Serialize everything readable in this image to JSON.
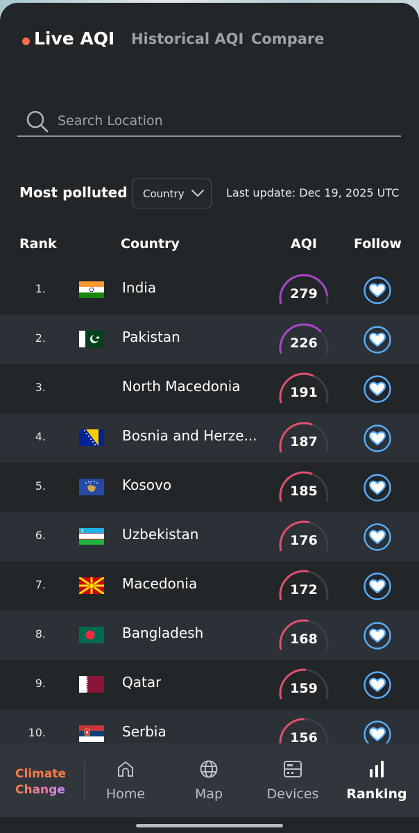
{
  "tabs": [
    {
      "label": "Live AQI",
      "active": true
    },
    {
      "label": "Historical AQI",
      "active": false
    },
    {
      "label": "Compare",
      "active": false
    }
  ],
  "search": {
    "placeholder": "Search Location",
    "value": ""
  },
  "filter": {
    "title": "Most polluted",
    "dropdown_selected": "Country",
    "last_update": "Last update: Dec 19, 2025 UTC"
  },
  "table": {
    "headers": {
      "rank": "Rank",
      "country": "Country",
      "aqi": "AQI",
      "follow": "Follow"
    },
    "rows": [
      {
        "rank": "1.",
        "country": "India",
        "aqi": 279,
        "flag": "india-flag",
        "gauge_color": "#a945c9",
        "gauge_fraction": 0.56
      },
      {
        "rank": "2.",
        "country": "Pakistan",
        "aqi": 226,
        "flag": "pakistan-flag",
        "gauge_color": "#a945c9",
        "gauge_fraction": 0.45
      },
      {
        "rank": "3.",
        "country": "North Macedonia",
        "aqi": 191,
        "flag": "none",
        "gauge_color": "#e0506c",
        "gauge_fraction": 0.38
      },
      {
        "rank": "4.",
        "country": "Bosnia and Herze...",
        "aqi": 187,
        "flag": "bosnia-flag",
        "gauge_color": "#e0506c",
        "gauge_fraction": 0.37
      },
      {
        "rank": "5.",
        "country": "Kosovo",
        "aqi": 185,
        "flag": "kosovo-flag",
        "gauge_color": "#e0506c",
        "gauge_fraction": 0.37
      },
      {
        "rank": "6.",
        "country": "Uzbekistan",
        "aqi": 176,
        "flag": "uzbekistan-flag",
        "gauge_color": "#e0506c",
        "gauge_fraction": 0.35
      },
      {
        "rank": "7.",
        "country": "Macedonia",
        "aqi": 172,
        "flag": "macedonia-flag",
        "gauge_color": "#e0506c",
        "gauge_fraction": 0.34
      },
      {
        "rank": "8.",
        "country": "Bangladesh",
        "aqi": 168,
        "flag": "bangladesh-flag",
        "gauge_color": "#e0506c",
        "gauge_fraction": 0.34
      },
      {
        "rank": "9.",
        "country": "Qatar",
        "aqi": 159,
        "flag": "qatar-flag",
        "gauge_color": "#e0506c",
        "gauge_fraction": 0.32
      },
      {
        "rank": "10.",
        "country": "Serbia",
        "aqi": 156,
        "flag": "serbia-flag",
        "gauge_color": "#e0506c",
        "gauge_fraction": 0.31
      }
    ]
  },
  "nav": {
    "brand": {
      "line1": "Climate",
      "line2": "Change"
    },
    "items": [
      {
        "label": "Home",
        "icon": "home-icon",
        "active": false
      },
      {
        "label": "Map",
        "icon": "globe-icon",
        "active": false
      },
      {
        "label": "Devices",
        "icon": "devices-icon",
        "active": false
      },
      {
        "label": "Ranking",
        "icon": "ranking-icon",
        "active": true
      }
    ]
  },
  "colors": {
    "background": "#222629",
    "row_alt": "#2b3136",
    "accent_dot": "#ff6b46",
    "follow_blue": "#5aaeff",
    "gauge_track": "#3a4046"
  }
}
